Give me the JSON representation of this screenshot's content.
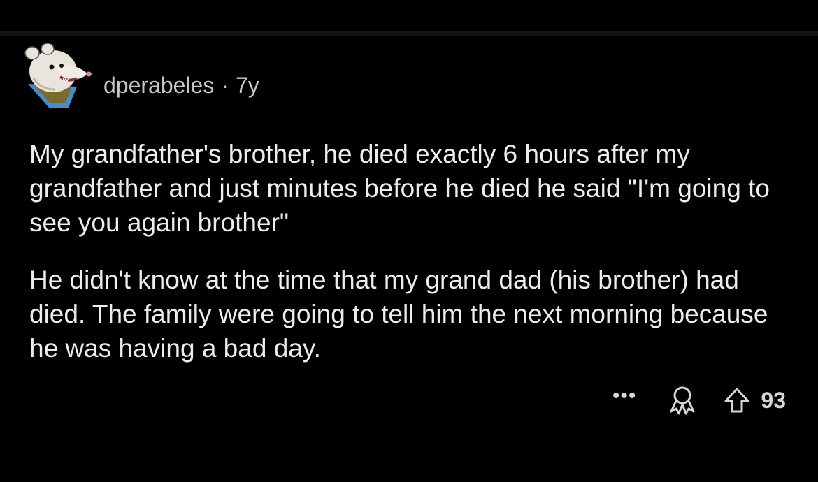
{
  "comment": {
    "username": "dperabeles",
    "separator": "·",
    "age": "7y",
    "paragraphs": [
      "My grandfather's brother, he died exactly 6 hours after my grandfather and just minutes before he died he said \"I'm going to see you again brother\"",
      "He didn't know at the time that my grand dad (his brother) had died. The family were going to tell him the next morning because he was having a bad day."
    ],
    "more_label": "•••",
    "score": "93",
    "avatar_icon": "opossum-avatar-icon",
    "award_icon": "award-icon",
    "upvote_icon": "upvote-arrow-icon"
  },
  "colors": {
    "background": "#000000",
    "text": "#ededed",
    "meta_text": "#c7c7c7",
    "divider": "#141414"
  }
}
